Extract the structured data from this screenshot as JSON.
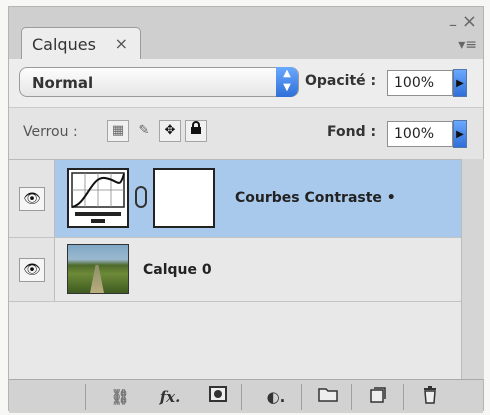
{
  "panel": {
    "tab_label": "Calques",
    "tab_close_glyph": "×",
    "minimize_glyph": "–",
    "close_glyph": "×",
    "menu_glyph": "▾≡"
  },
  "blend": {
    "mode": "Normal"
  },
  "opacity": {
    "label": "Opacité :",
    "value": "100%"
  },
  "lock": {
    "label": "Verrou :"
  },
  "fill": {
    "label": "Fond :",
    "value": "100%"
  },
  "layers": [
    {
      "name": "Courbes Contraste",
      "selected": true,
      "type": "adjustment"
    },
    {
      "name": "Calque 0",
      "selected": false,
      "type": "image"
    }
  ],
  "icons": {
    "eye": "eye-icon",
    "lock_transparent": "lock-transparent-icon",
    "lock_paint": "lock-paint-icon",
    "lock_move": "lock-move-icon",
    "lock_all": "lock-all-icon",
    "link": "link-layers-icon",
    "fx": "fx-icon",
    "mask": "add-mask-icon",
    "adjustment": "new-adjustment-icon",
    "group": "new-group-icon",
    "new_layer": "new-layer-icon",
    "trash": "trash-icon"
  },
  "colors": {
    "selection": "#a9c9ec",
    "accent": "#2f6fd8"
  }
}
